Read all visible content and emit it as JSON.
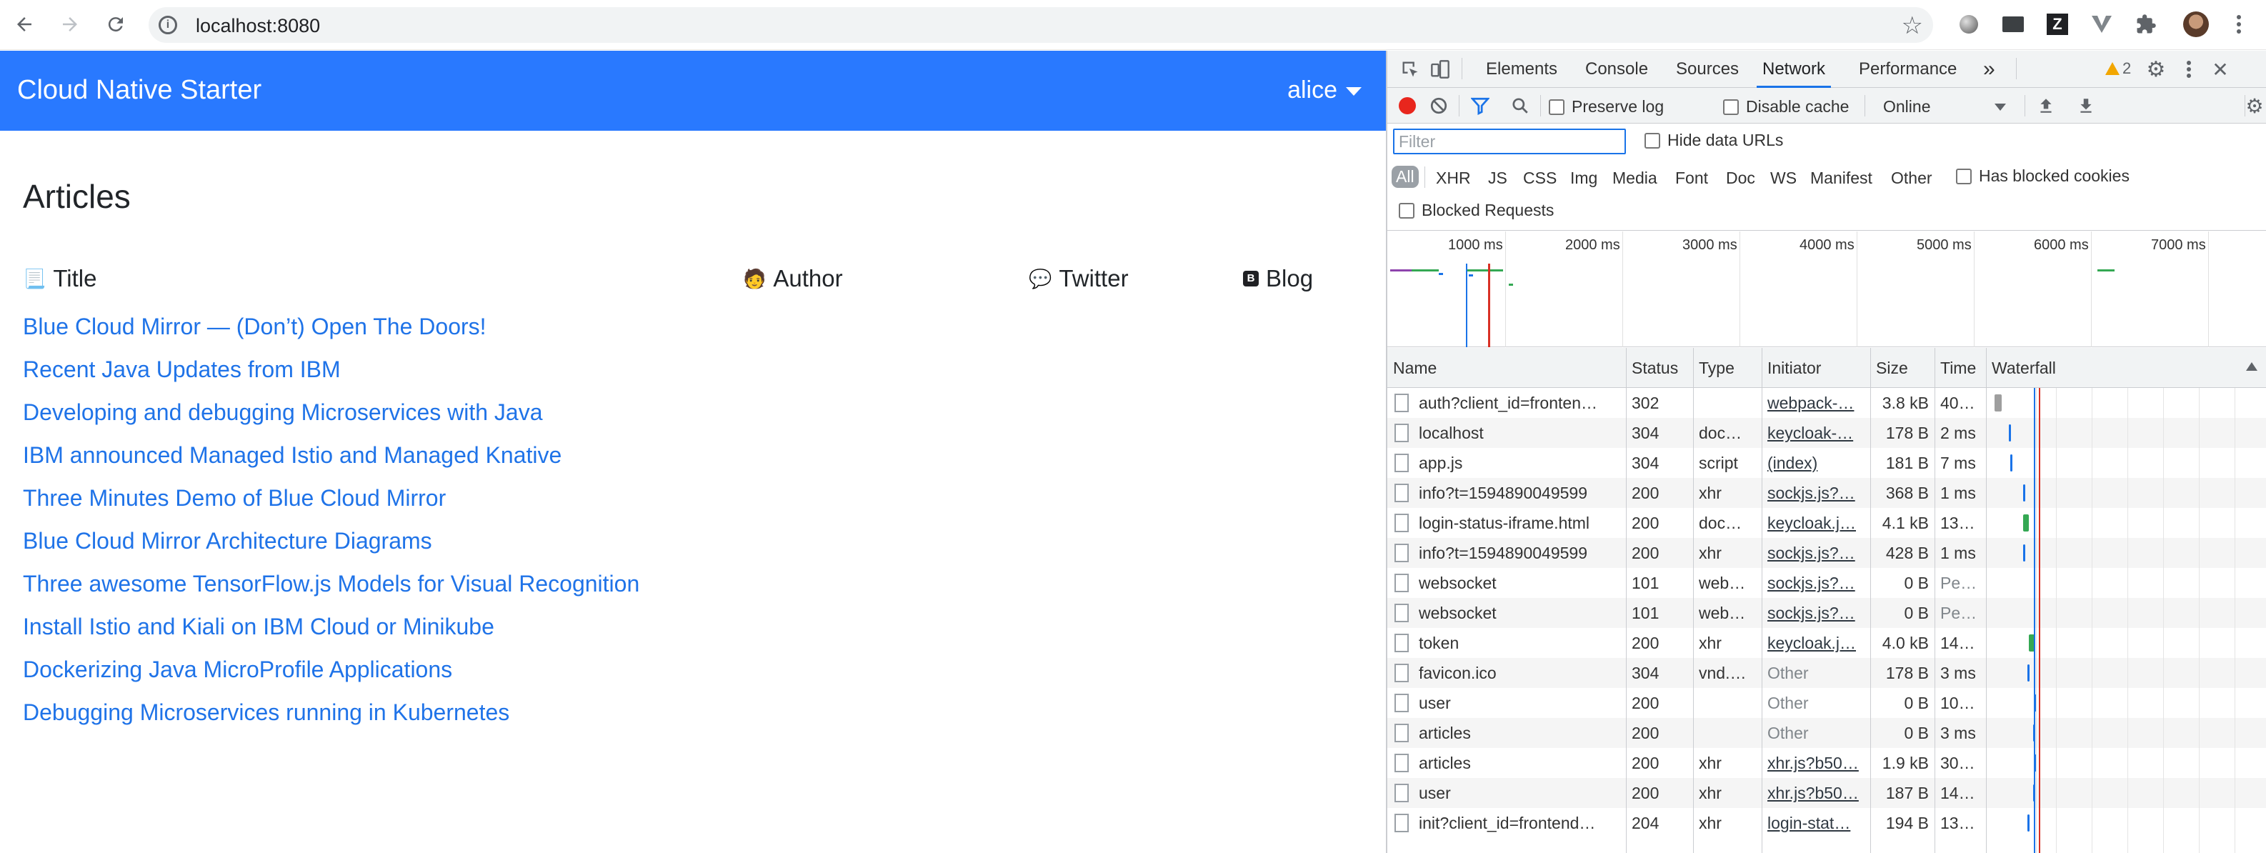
{
  "browser": {
    "url": "localhost:8080"
  },
  "app": {
    "brand": "Cloud Native Starter",
    "user": "alice",
    "heading": "Articles",
    "columns": {
      "title": "Title",
      "author": "Author",
      "twitter": "Twitter",
      "blog": "Blog"
    },
    "articles": [
      "Blue Cloud Mirror — (Don’t) Open The Doors!",
      "Recent Java Updates from IBM",
      "Developing and debugging Microservices with Java",
      "IBM announced Managed Istio and Managed Knative",
      "Three Minutes Demo of Blue Cloud Mirror",
      "Blue Cloud Mirror Architecture Diagrams",
      "Three awesome TensorFlow.js Models for Visual Recognition",
      "Install Istio and Kiali on IBM Cloud or Minikube",
      "Dockerizing Java MicroProfile Applications",
      "Debugging Microservices running in Kubernetes"
    ]
  },
  "devtools": {
    "tabs": [
      "Elements",
      "Console",
      "Sources",
      "Network",
      "Performance"
    ],
    "active_tab": "Network",
    "more_tabs": "»",
    "warnings": "2",
    "toolbar": {
      "preserve_log": "Preserve log",
      "disable_cache": "Disable cache",
      "throttling": "Online"
    },
    "filter": {
      "placeholder": "Filter",
      "hide_data_urls": "Hide data URLs",
      "types": [
        "All",
        "XHR",
        "JS",
        "CSS",
        "Img",
        "Media",
        "Font",
        "Doc",
        "WS",
        "Manifest",
        "Other"
      ],
      "has_blocked_cookies": "Has blocked cookies",
      "blocked_requests": "Blocked Requests"
    },
    "timeline_labels": [
      "1000 ms",
      "2000 ms",
      "3000 ms",
      "4000 ms",
      "5000 ms",
      "6000 ms",
      "7000 ms"
    ],
    "table_headers": {
      "name": "Name",
      "status": "Status",
      "type": "Type",
      "initiator": "Initiator",
      "size": "Size",
      "time": "Time",
      "waterfall": "Waterfall"
    },
    "requests": [
      {
        "name": "auth?client_id=fronten…",
        "status": "302",
        "type": "",
        "initiator": "webpack-…",
        "size": "3.8 kB",
        "time": "40…"
      },
      {
        "name": "localhost",
        "status": "304",
        "type": "doc…",
        "initiator": "keycloak-…",
        "size": "178 B",
        "time": "2 ms"
      },
      {
        "name": "app.js",
        "status": "304",
        "type": "script",
        "initiator": "(index)",
        "size": "181 B",
        "time": "7 ms"
      },
      {
        "name": "info?t=1594890049599",
        "status": "200",
        "type": "xhr",
        "initiator": "sockjs.js?…",
        "size": "368 B",
        "time": "1 ms"
      },
      {
        "name": "login-status-iframe.html",
        "status": "200",
        "type": "doc…",
        "initiator": "keycloak.j…",
        "size": "4.1 kB",
        "time": "13…"
      },
      {
        "name": "info?t=1594890049599",
        "status": "200",
        "type": "xhr",
        "initiator": "sockjs.js?…",
        "size": "428 B",
        "time": "1 ms"
      },
      {
        "name": "websocket",
        "status": "101",
        "type": "web…",
        "initiator": "sockjs.js?…",
        "size": "0 B",
        "time": "Pe…"
      },
      {
        "name": "websocket",
        "status": "101",
        "type": "web…",
        "initiator": "sockjs.js?…",
        "size": "0 B",
        "time": "Pe…"
      },
      {
        "name": "token",
        "status": "200",
        "type": "xhr",
        "initiator": "keycloak.j…",
        "size": "4.0 kB",
        "time": "14…"
      },
      {
        "name": "favicon.ico",
        "status": "304",
        "type": "vnd.…",
        "initiator": "Other",
        "size": "178 B",
        "time": "3 ms"
      },
      {
        "name": "user",
        "status": "200",
        "type": "",
        "initiator": "Other",
        "size": "0 B",
        "time": "10…"
      },
      {
        "name": "articles",
        "status": "200",
        "type": "",
        "initiator": "Other",
        "size": "0 B",
        "time": "3 ms"
      },
      {
        "name": "articles",
        "status": "200",
        "type": "xhr",
        "initiator": "xhr.js?b50…",
        "size": "1.9 kB",
        "time": "30…"
      },
      {
        "name": "user",
        "status": "200",
        "type": "xhr",
        "initiator": "xhr.js?b50…",
        "size": "187 B",
        "time": "14…"
      },
      {
        "name": "init?client_id=frontend…",
        "status": "204",
        "type": "xhr",
        "initiator": "login-stat…",
        "size": "194 B",
        "time": "13…"
      }
    ]
  },
  "colors": {
    "navbar": "#2979ff",
    "link": "#1f73e8",
    "accent": "#1a73e8",
    "record": "#e8261d"
  }
}
